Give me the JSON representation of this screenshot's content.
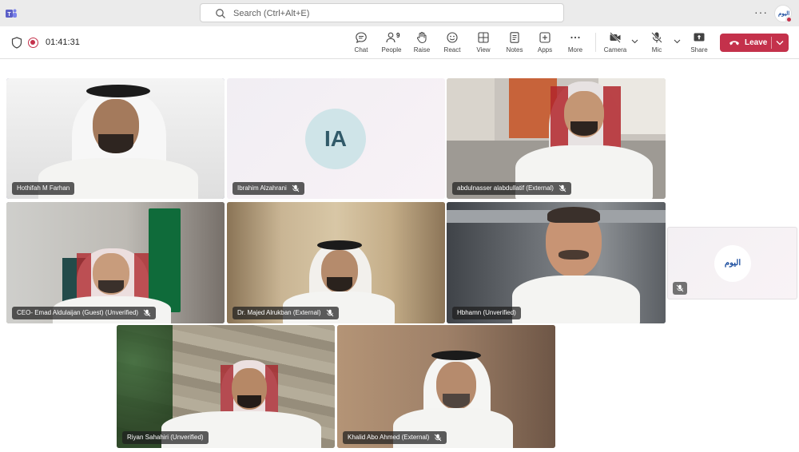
{
  "search": {
    "placeholder": "Search (Ctrl+Alt+E)"
  },
  "meeting": {
    "timer": "01:41:31"
  },
  "toolbar": {
    "chat": "Chat",
    "people": "People",
    "people_count": "9",
    "raise": "Raise",
    "react": "React",
    "view": "View",
    "notes": "Notes",
    "apps": "Apps",
    "more": "More",
    "camera": "Camera",
    "mic": "Mic",
    "share": "Share",
    "leave": "Leave"
  },
  "profile": {
    "logo_text": "اليوم"
  },
  "participants": [
    {
      "name": "Hothifah M Farhan",
      "muted": false,
      "speaking": true
    },
    {
      "name": "Ibrahim Alzahrani",
      "initials": "IA",
      "muted": true
    },
    {
      "name": "abdulnasser alabdullatif (External)",
      "muted": true
    },
    {
      "name": "CEO- Emad Aldulaijan (Guest) (Unverified)",
      "muted": true
    },
    {
      "name": "Dr. Majed Alrukban (External)",
      "muted": true
    },
    {
      "name": "Hbhamn (Unverified)",
      "muted": false
    },
    {
      "logo_text": "اليوم",
      "muted": true
    },
    {
      "name": "Riyan Sahahiri (Unverified)",
      "muted": false
    },
    {
      "name": "Khalid Abo Ahmed (External)",
      "muted": true
    }
  ],
  "colors": {
    "accent": "#6264a7",
    "leave": "#c4314b",
    "nameplate": "#1e1e1e"
  }
}
